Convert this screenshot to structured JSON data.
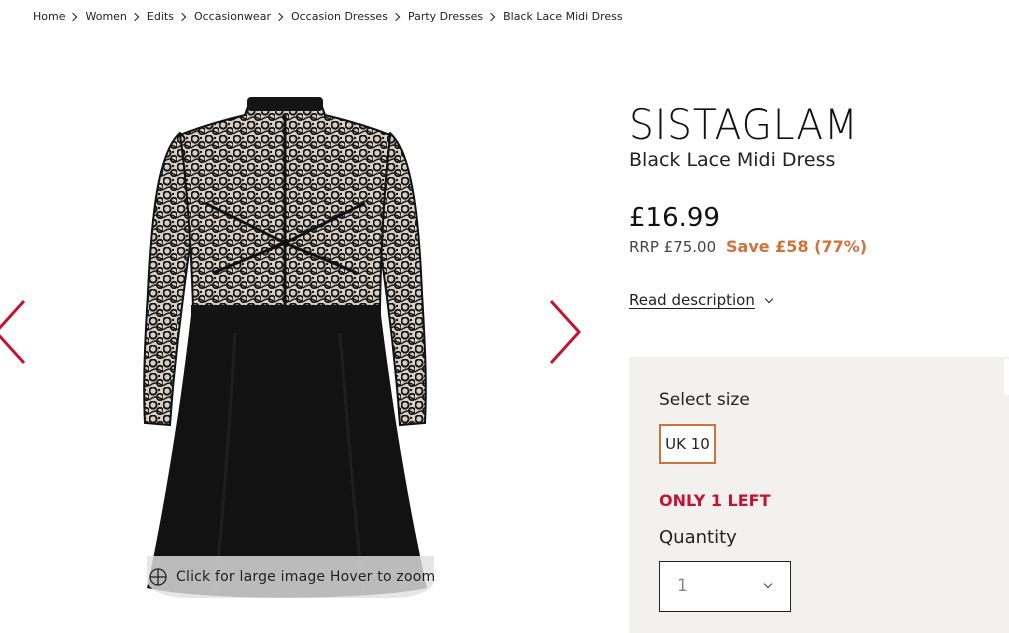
{
  "breadcrumb": [
    {
      "label": "Home"
    },
    {
      "label": "Women"
    },
    {
      "label": "Edits"
    },
    {
      "label": "Occasionwear"
    },
    {
      "label": "Occasion Dresses"
    },
    {
      "label": "Party Dresses"
    },
    {
      "label": "Black Lace Midi Dress"
    }
  ],
  "gallery": {
    "zoom_hint": "Click for large image Hover to zoom",
    "arrow_color": "#c41230"
  },
  "product": {
    "brand": "SISTAGLAM",
    "name": "Black Lace Midi Dress",
    "price": "£16.99",
    "rrp": "RRP £75.00",
    "save": "Save £58 (77%)",
    "read_description": "Read description"
  },
  "options": {
    "select_size_label": "Select size",
    "sizes": [
      {
        "label": "UK 10",
        "selected": true
      }
    ],
    "stock_warning": "ONLY 1 LEFT",
    "quantity_label": "Quantity",
    "quantity_value": "1"
  },
  "colors": {
    "accent_orange": "#d0733a",
    "alert_red": "#c41230",
    "panel_bg": "#f2f1ef"
  }
}
